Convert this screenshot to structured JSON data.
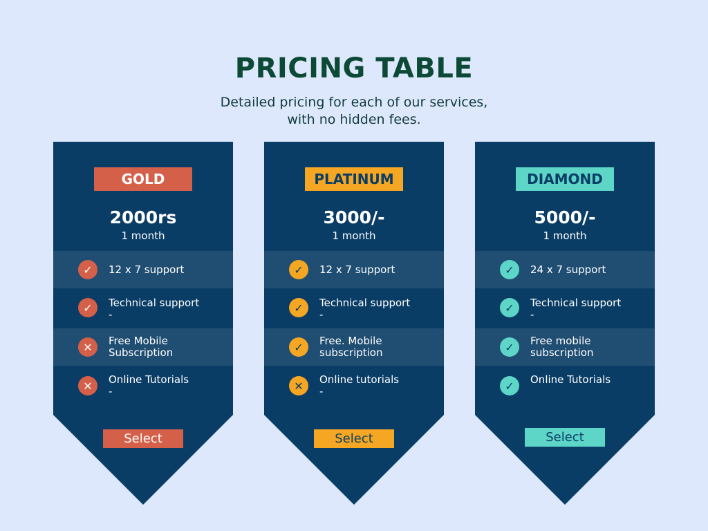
{
  "header": {
    "title": "PRICING TABLE",
    "subtitle_line1": "Detailed pricing for each of our services,",
    "subtitle_line2": "with no hidden fees."
  },
  "colors": {
    "background": "#dde8fd",
    "card": "#0a3d66",
    "gold": "#d5604a",
    "platinum": "#f5a623",
    "diamond": "#5dd6c8",
    "title": "#0c4a36"
  },
  "plans": [
    {
      "name": "GOLD",
      "price": "2000rs",
      "period": "1 month",
      "select_label": "Select",
      "features": [
        {
          "line1": "12 x 7 support",
          "line2": "",
          "icon": "check-icon",
          "glyph": "✓"
        },
        {
          "line1": "Technical support",
          "line2": "-",
          "icon": "check-icon",
          "glyph": "✓"
        },
        {
          "line1": "Free   Mobile",
          "line2": "Subscription",
          "icon": "cross-icon",
          "glyph": "✕"
        },
        {
          "line1": "Online Tutorials",
          "line2": "-",
          "icon": "cross-icon",
          "glyph": "✕"
        }
      ]
    },
    {
      "name": "PLATINUM",
      "price": "3000/-",
      "period": "1 month",
      "select_label": "Select",
      "features": [
        {
          "line1": "12 x 7 support",
          "line2": "",
          "icon": "check-icon",
          "glyph": "✓"
        },
        {
          "line1": "Technical support",
          "line2": "-",
          "icon": "check-icon",
          "glyph": "✓"
        },
        {
          "line1": "Free.  Mobile",
          "line2": "subscription",
          "icon": "check-icon",
          "glyph": "✓"
        },
        {
          "line1": "Online tutorials",
          "line2": "-",
          "icon": "cross-icon",
          "glyph": "✕"
        }
      ]
    },
    {
      "name": "DIAMOND",
      "price": "5000/-",
      "period": "1 month",
      "select_label": "Select",
      "features": [
        {
          "line1": "24 x 7 support",
          "line2": "",
          "icon": "check-icon",
          "glyph": "✓"
        },
        {
          "line1": "Technical support",
          "line2": "-",
          "icon": "check-icon",
          "glyph": "✓"
        },
        {
          "line1": "Free   mobile",
          "line2": "subscription",
          "icon": "check-icon",
          "glyph": "✓"
        },
        {
          "line1": "Online Tutorials",
          "line2": "",
          "icon": "check-icon",
          "glyph": "✓"
        }
      ]
    }
  ]
}
